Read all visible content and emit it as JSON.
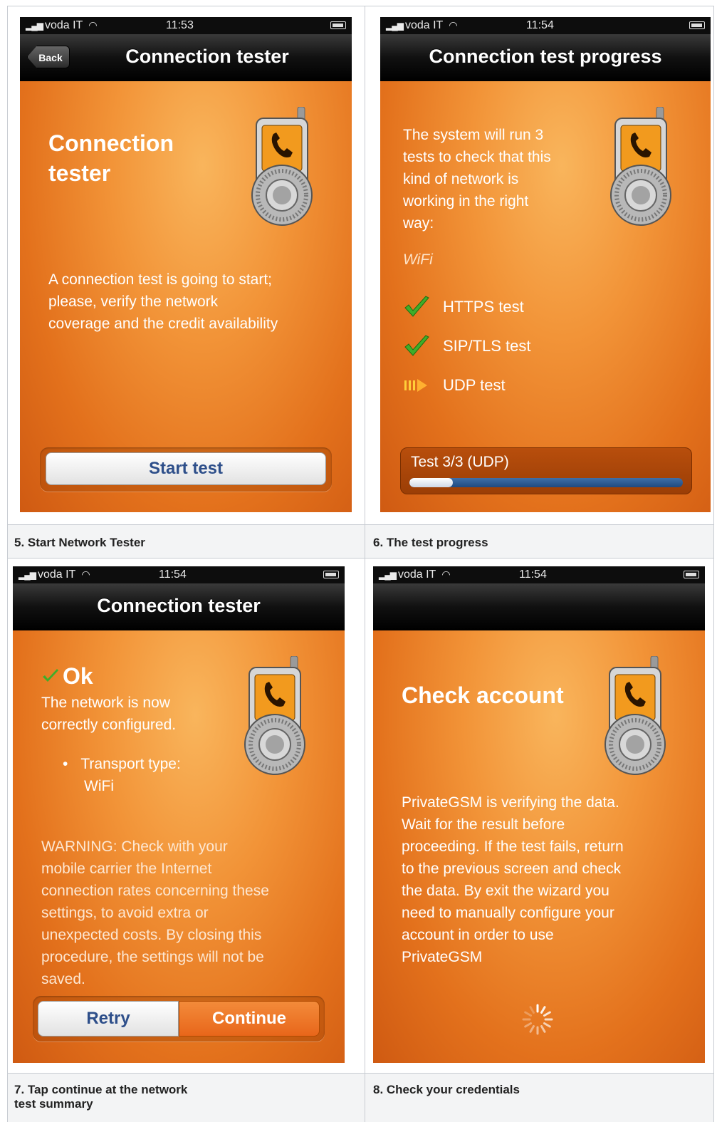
{
  "panels": [
    {
      "status": {
        "carrier": "voda IT",
        "time": "11:53"
      },
      "nav": {
        "back": "Back",
        "title": "Connection tester"
      },
      "headline_lines": [
        "Connection",
        "tester"
      ],
      "body_lines": [
        "A connection test is going to start;",
        "please, verify the network",
        "coverage and the credit availability"
      ],
      "button": "Start test",
      "caption": "5. Start Network Tester"
    },
    {
      "status": {
        "carrier": "voda IT",
        "time": "11:54"
      },
      "nav": {
        "title": "Connection test progress"
      },
      "intro_lines": [
        "The system will run 3",
        "tests to check that this",
        "kind of network is",
        "working in the right",
        "way:"
      ],
      "network": "WiFi",
      "tests": [
        {
          "label": "HTTPS test",
          "state": "done"
        },
        {
          "label": "SIP/TLS test",
          "state": "done"
        },
        {
          "label": "UDP test",
          "state": "running"
        }
      ],
      "progress": {
        "label": "Test 3/3 (UDP)",
        "fraction": 0.16
      },
      "caption": "6. The test progress"
    },
    {
      "status": {
        "carrier": "voda IT",
        "time": "11:54"
      },
      "nav": {
        "title": "Connection tester"
      },
      "ok": "Ok",
      "ok_lines": [
        "The network is now",
        "correctly configured."
      ],
      "bullet_lines": [
        "Transport type:",
        "WiFi"
      ],
      "warning_lines": [
        "WARNING: Check with your",
        "mobile carrier the Internet",
        "connection rates concerning these",
        "settings, to avoid extra or",
        "unexpected costs. By closing this",
        "procedure, the settings will not be",
        "saved."
      ],
      "buttons": {
        "retry": "Retry",
        "continue": "Continue"
      },
      "caption_lines": [
        "7. Tap continue at the network",
        "test summary"
      ]
    },
    {
      "status": {
        "carrier": "voda IT",
        "time": "11:54"
      },
      "headline": "Check account",
      "body_lines": [
        "PrivateGSM is verifying the data.",
        "Wait for the result before",
        "proceeding. If the test fails, return",
        "to the previous screen and check",
        "the data. By exit the wizard you",
        "need to manually configure your",
        "account in order to use",
        "PrivateGSM"
      ],
      "caption": "8. Check your credentials"
    }
  ],
  "icons": {
    "signal": "signal-bars-icon",
    "wifi": "wifi-icon",
    "battery": "battery-icon",
    "lock": "phone-lock-icon",
    "check": "checkmark-icon",
    "arrow": "progress-arrow-icon",
    "spinner": "loading-spinner-icon"
  },
  "colors": {
    "accent_orange": "#f29438",
    "button_text_blue": "#2e4f8a",
    "check_green": "#3fae2a"
  }
}
